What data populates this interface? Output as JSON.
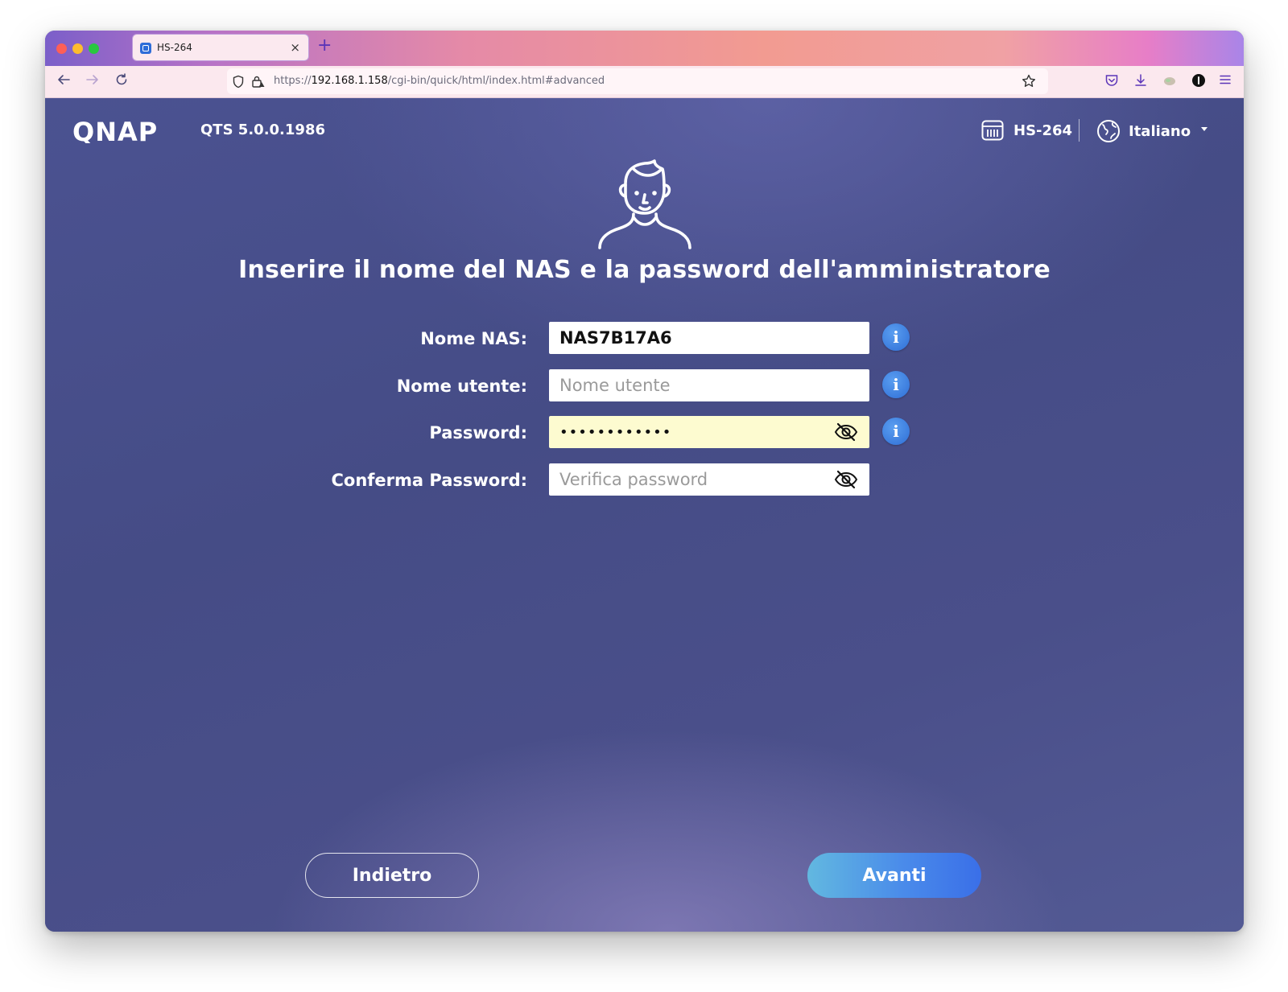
{
  "browser": {
    "tab_title": "HS-264",
    "tab_close": "×",
    "new_tab": "+",
    "url_prefix": "https://",
    "url_host": "192.168.1.158",
    "url_path": "/cgi-bin/quick/html/index.html#advanced"
  },
  "header": {
    "logo": "QNAP",
    "version": "QTS 5.0.0.1986",
    "device": "HS-264",
    "language": "Italiano"
  },
  "page": {
    "title": "Inserire il nome del NAS e la password dell'amministratore"
  },
  "form": {
    "nas_name": {
      "label": "Nome NAS:",
      "value": "NAS7B17A6"
    },
    "username": {
      "label": "Nome utente:",
      "placeholder": "Nome utente",
      "value": ""
    },
    "password": {
      "label": "Password:",
      "value": "••••••••••••"
    },
    "confirm_password": {
      "label": "Conferma Password:",
      "placeholder": "Verifica password",
      "value": ""
    }
  },
  "buttons": {
    "back": "Indietro",
    "next": "Avanti"
  },
  "colors": {
    "background": "#4a4f8a",
    "info_blue": "#2f6ed6",
    "next_button_start": "#62b8e0",
    "next_button_end": "#3a6fe8",
    "password_field_bg": "#fdfbd0"
  }
}
